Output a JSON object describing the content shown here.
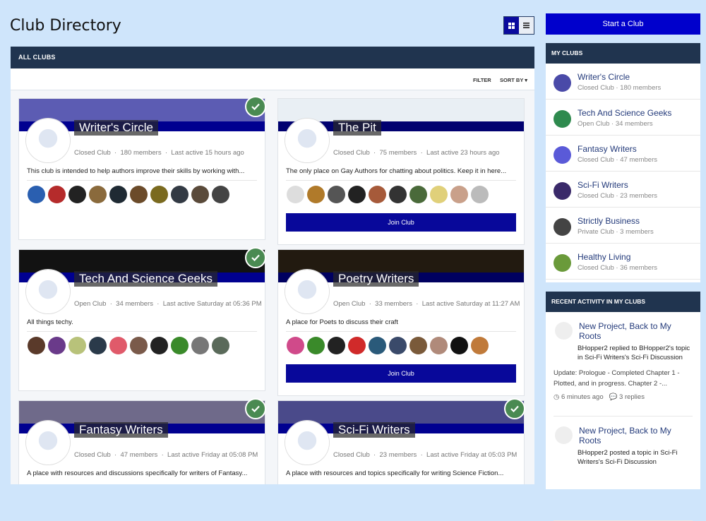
{
  "page": {
    "title": "Club Directory"
  },
  "main": {
    "header": "ALL CLUBS",
    "filter_label": "FILTER",
    "sort_label": "SORT BY ▾"
  },
  "join_label": "Join Club",
  "clubs": [
    {
      "name": "Writer's Circle",
      "type": "Closed Club",
      "members": "180 members",
      "last_active": "Last active 15 hours ago",
      "description": "This club is intended to help authors improve their skills by working with...",
      "joined": true,
      "banner_color": "#5c5cb3",
      "stripe_color": "#000090",
      "member_avatars": [
        "#2a5fb0",
        "#b52b2b",
        "#222222",
        "#8a6a3c",
        "#1f2a33",
        "#6b4b2a",
        "#7a6a1f",
        "#333a44",
        "#5a4a3a",
        "#444444"
      ]
    },
    {
      "name": "The Pit",
      "type": "Closed Club",
      "members": "75 members",
      "last_active": "Last active 23 hours ago",
      "description": "The only place on Gay Authors for chatting about politics. Keep it in here...",
      "joined": false,
      "banner_color": "#e9eff4",
      "stripe_color": "#000070",
      "member_avatars": [
        "#dddddd",
        "#b07a2a",
        "#555555",
        "#222222",
        "#a65a3a",
        "#333333",
        "#4a6a3a",
        "#e0d07a",
        "#c9a08a",
        "#bbbbbb"
      ]
    },
    {
      "name": "Tech And Science Geeks",
      "type": "Open Club",
      "members": "34 members",
      "last_active": "Last active Saturday at 05:36 PM",
      "description": "All things techy.",
      "joined": true,
      "banner_color": "#121212",
      "stripe_color": "#000090",
      "member_avatars": [
        "#5a3a2a",
        "#6a3a8a",
        "#b8c27a",
        "#2a3a4a",
        "#e05a6a",
        "#7a5a4a",
        "#222222",
        "#3a8a2a",
        "#777777",
        "#5a6a5a"
      ]
    },
    {
      "name": "Poetry Writers",
      "type": "Open Club",
      "members": "33 members",
      "last_active": "Last active Saturday at 11:27 AM",
      "description": "A place for Poets to discuss their craft",
      "joined": false,
      "banner_color": "#221a10",
      "stripe_color": "#000060",
      "member_avatars": [
        "#d04a8a",
        "#3a8a2a",
        "#222222",
        "#d02a2a",
        "#2a5a7a",
        "#3a4a6a",
        "#7a5a3a",
        "#b08a7a",
        "#111111",
        "#c07a3a"
      ]
    },
    {
      "name": "Fantasy Writers",
      "type": "Closed Club",
      "members": "47 members",
      "last_active": "Last active Friday at 05:08 PM",
      "description": "A place with resources and discussions specifically for writers of Fantasy...",
      "joined": true,
      "banner_color": "#6f6a8a",
      "stripe_color": "#000090",
      "member_avatars": []
    },
    {
      "name": "Sci-Fi Writers",
      "type": "Closed Club",
      "members": "23 members",
      "last_active": "Last active Friday at 05:03 PM",
      "description": "A place with resources and topics specifically for writing Science Fiction...",
      "joined": true,
      "banner_color": "#4a4a8a",
      "stripe_color": "#000090",
      "member_avatars": []
    }
  ],
  "sidebar": {
    "start_club": "Start a Club",
    "my_clubs_header": "MY CLUBS",
    "my_clubs": [
      {
        "name": "Writer's Circle",
        "meta": "Closed Club · 180 members",
        "icon_color": "#4a4aa8"
      },
      {
        "name": "Tech And Science Geeks",
        "meta": "Open Club · 34 members",
        "icon_color": "#2e8a4e"
      },
      {
        "name": "Fantasy Writers",
        "meta": "Closed Club · 47 members",
        "icon_color": "#5a5ad8"
      },
      {
        "name": "Sci-Fi Writers",
        "meta": "Closed Club · 23 members",
        "icon_color": "#3a2a6a"
      },
      {
        "name": "Strictly Business",
        "meta": "Private Club · 3 members",
        "icon_color": "#444444"
      },
      {
        "name": "Healthy Living",
        "meta": "Closed Club · 36 members",
        "icon_color": "#6a9a3a"
      }
    ],
    "activity_header": "RECENT ACTIVITY IN MY CLUBS",
    "activity": [
      {
        "title": "New Project, Back to My Roots",
        "summary": "BHopper2 replied to BHopper2's topic in Sci-Fi Writers's Sci-Fi Discussion",
        "excerpt": "Update: Prologue - Completed Chapter 1 - Plotted, and in progress. Chapter 2 -...",
        "time": "6 minutes ago",
        "replies": "3 replies"
      },
      {
        "title": "New Project, Back to My Roots",
        "summary": "BHopper2 posted a topic in Sci-Fi Writers's Sci-Fi Discussion",
        "excerpt": "",
        "time": "",
        "replies": ""
      }
    ]
  }
}
